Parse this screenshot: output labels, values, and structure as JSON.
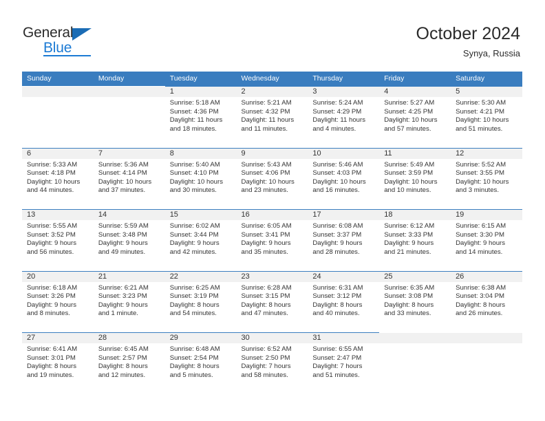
{
  "brand": {
    "name_top": "General",
    "name_bottom": "Blue",
    "accent_color": "#1b7ad4",
    "triangle_color": "#1b6cb5"
  },
  "header": {
    "title": "October 2024",
    "subtitle": "Synya, Russia"
  },
  "calendar": {
    "header_bg": "#3a7dbf",
    "daynum_bg": "#f1f1f1",
    "weekdays": [
      "Sunday",
      "Monday",
      "Tuesday",
      "Wednesday",
      "Thursday",
      "Friday",
      "Saturday"
    ],
    "weeks": [
      [
        {
          "day": "",
          "sunrise": "",
          "sunset": "",
          "daylight1": "",
          "daylight2": ""
        },
        {
          "day": "",
          "sunrise": "",
          "sunset": "",
          "daylight1": "",
          "daylight2": ""
        },
        {
          "day": "1",
          "sunrise": "Sunrise: 5:18 AM",
          "sunset": "Sunset: 4:36 PM",
          "daylight1": "Daylight: 11 hours",
          "daylight2": "and 18 minutes."
        },
        {
          "day": "2",
          "sunrise": "Sunrise: 5:21 AM",
          "sunset": "Sunset: 4:32 PM",
          "daylight1": "Daylight: 11 hours",
          "daylight2": "and 11 minutes."
        },
        {
          "day": "3",
          "sunrise": "Sunrise: 5:24 AM",
          "sunset": "Sunset: 4:29 PM",
          "daylight1": "Daylight: 11 hours",
          "daylight2": "and 4 minutes."
        },
        {
          "day": "4",
          "sunrise": "Sunrise: 5:27 AM",
          "sunset": "Sunset: 4:25 PM",
          "daylight1": "Daylight: 10 hours",
          "daylight2": "and 57 minutes."
        },
        {
          "day": "5",
          "sunrise": "Sunrise: 5:30 AM",
          "sunset": "Sunset: 4:21 PM",
          "daylight1": "Daylight: 10 hours",
          "daylight2": "and 51 minutes."
        }
      ],
      [
        {
          "day": "6",
          "sunrise": "Sunrise: 5:33 AM",
          "sunset": "Sunset: 4:18 PM",
          "daylight1": "Daylight: 10 hours",
          "daylight2": "and 44 minutes."
        },
        {
          "day": "7",
          "sunrise": "Sunrise: 5:36 AM",
          "sunset": "Sunset: 4:14 PM",
          "daylight1": "Daylight: 10 hours",
          "daylight2": "and 37 minutes."
        },
        {
          "day": "8",
          "sunrise": "Sunrise: 5:40 AM",
          "sunset": "Sunset: 4:10 PM",
          "daylight1": "Daylight: 10 hours",
          "daylight2": "and 30 minutes."
        },
        {
          "day": "9",
          "sunrise": "Sunrise: 5:43 AM",
          "sunset": "Sunset: 4:06 PM",
          "daylight1": "Daylight: 10 hours",
          "daylight2": "and 23 minutes."
        },
        {
          "day": "10",
          "sunrise": "Sunrise: 5:46 AM",
          "sunset": "Sunset: 4:03 PM",
          "daylight1": "Daylight: 10 hours",
          "daylight2": "and 16 minutes."
        },
        {
          "day": "11",
          "sunrise": "Sunrise: 5:49 AM",
          "sunset": "Sunset: 3:59 PM",
          "daylight1": "Daylight: 10 hours",
          "daylight2": "and 10 minutes."
        },
        {
          "day": "12",
          "sunrise": "Sunrise: 5:52 AM",
          "sunset": "Sunset: 3:55 PM",
          "daylight1": "Daylight: 10 hours",
          "daylight2": "and 3 minutes."
        }
      ],
      [
        {
          "day": "13",
          "sunrise": "Sunrise: 5:55 AM",
          "sunset": "Sunset: 3:52 PM",
          "daylight1": "Daylight: 9 hours",
          "daylight2": "and 56 minutes."
        },
        {
          "day": "14",
          "sunrise": "Sunrise: 5:59 AM",
          "sunset": "Sunset: 3:48 PM",
          "daylight1": "Daylight: 9 hours",
          "daylight2": "and 49 minutes."
        },
        {
          "day": "15",
          "sunrise": "Sunrise: 6:02 AM",
          "sunset": "Sunset: 3:44 PM",
          "daylight1": "Daylight: 9 hours",
          "daylight2": "and 42 minutes."
        },
        {
          "day": "16",
          "sunrise": "Sunrise: 6:05 AM",
          "sunset": "Sunset: 3:41 PM",
          "daylight1": "Daylight: 9 hours",
          "daylight2": "and 35 minutes."
        },
        {
          "day": "17",
          "sunrise": "Sunrise: 6:08 AM",
          "sunset": "Sunset: 3:37 PM",
          "daylight1": "Daylight: 9 hours",
          "daylight2": "and 28 minutes."
        },
        {
          "day": "18",
          "sunrise": "Sunrise: 6:12 AM",
          "sunset": "Sunset: 3:33 PM",
          "daylight1": "Daylight: 9 hours",
          "daylight2": "and 21 minutes."
        },
        {
          "day": "19",
          "sunrise": "Sunrise: 6:15 AM",
          "sunset": "Sunset: 3:30 PM",
          "daylight1": "Daylight: 9 hours",
          "daylight2": "and 14 minutes."
        }
      ],
      [
        {
          "day": "20",
          "sunrise": "Sunrise: 6:18 AM",
          "sunset": "Sunset: 3:26 PM",
          "daylight1": "Daylight: 9 hours",
          "daylight2": "and 8 minutes."
        },
        {
          "day": "21",
          "sunrise": "Sunrise: 6:21 AM",
          "sunset": "Sunset: 3:23 PM",
          "daylight1": "Daylight: 9 hours",
          "daylight2": "and 1 minute."
        },
        {
          "day": "22",
          "sunrise": "Sunrise: 6:25 AM",
          "sunset": "Sunset: 3:19 PM",
          "daylight1": "Daylight: 8 hours",
          "daylight2": "and 54 minutes."
        },
        {
          "day": "23",
          "sunrise": "Sunrise: 6:28 AM",
          "sunset": "Sunset: 3:15 PM",
          "daylight1": "Daylight: 8 hours",
          "daylight2": "and 47 minutes."
        },
        {
          "day": "24",
          "sunrise": "Sunrise: 6:31 AM",
          "sunset": "Sunset: 3:12 PM",
          "daylight1": "Daylight: 8 hours",
          "daylight2": "and 40 minutes."
        },
        {
          "day": "25",
          "sunrise": "Sunrise: 6:35 AM",
          "sunset": "Sunset: 3:08 PM",
          "daylight1": "Daylight: 8 hours",
          "daylight2": "and 33 minutes."
        },
        {
          "day": "26",
          "sunrise": "Sunrise: 6:38 AM",
          "sunset": "Sunset: 3:04 PM",
          "daylight1": "Daylight: 8 hours",
          "daylight2": "and 26 minutes."
        }
      ],
      [
        {
          "day": "27",
          "sunrise": "Sunrise: 6:41 AM",
          "sunset": "Sunset: 3:01 PM",
          "daylight1": "Daylight: 8 hours",
          "daylight2": "and 19 minutes."
        },
        {
          "day": "28",
          "sunrise": "Sunrise: 6:45 AM",
          "sunset": "Sunset: 2:57 PM",
          "daylight1": "Daylight: 8 hours",
          "daylight2": "and 12 minutes."
        },
        {
          "day": "29",
          "sunrise": "Sunrise: 6:48 AM",
          "sunset": "Sunset: 2:54 PM",
          "daylight1": "Daylight: 8 hours",
          "daylight2": "and 5 minutes."
        },
        {
          "day": "30",
          "sunrise": "Sunrise: 6:52 AM",
          "sunset": "Sunset: 2:50 PM",
          "daylight1": "Daylight: 7 hours",
          "daylight2": "and 58 minutes."
        },
        {
          "day": "31",
          "sunrise": "Sunrise: 6:55 AM",
          "sunset": "Sunset: 2:47 PM",
          "daylight1": "Daylight: 7 hours",
          "daylight2": "and 51 minutes."
        },
        {
          "day": "",
          "sunrise": "",
          "sunset": "",
          "daylight1": "",
          "daylight2": ""
        },
        {
          "day": "",
          "sunrise": "",
          "sunset": "",
          "daylight1": "",
          "daylight2": ""
        }
      ]
    ]
  }
}
